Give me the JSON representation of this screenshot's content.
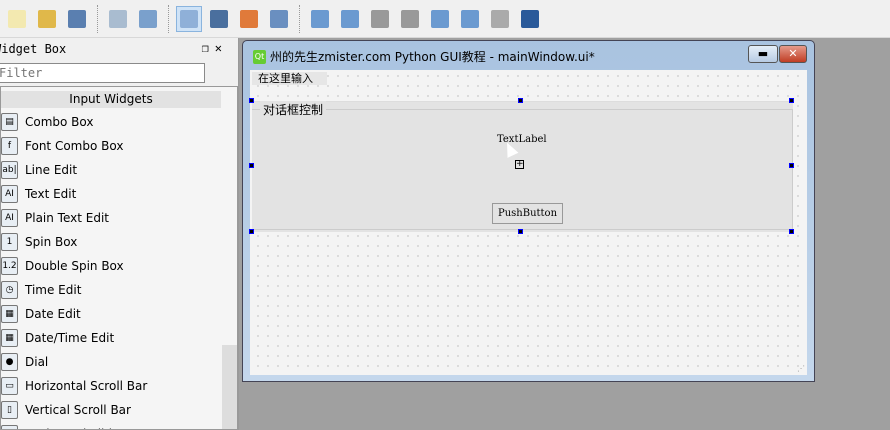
{
  "toolbar": {
    "buttons": [
      "new-file",
      "open-folder",
      "save",
      "send-to-back",
      "bring-to-front",
      "edit-widgets",
      "edit-signals-slots",
      "edit-buddies",
      "edit-tab-order",
      "layout-horizontal",
      "layout-vertical",
      "layout-h-splitter",
      "layout-v-splitter",
      "layout-grid",
      "layout-form",
      "break-layout",
      "adjust-size"
    ],
    "active": "edit-widgets"
  },
  "widget_box": {
    "title": "Widget Box",
    "filter_placeholder": "Filter",
    "category": "Input Widgets",
    "items": [
      {
        "label": "Combo Box",
        "icon": "▤"
      },
      {
        "label": "Font Combo Box",
        "icon": "f"
      },
      {
        "label": "Line Edit",
        "icon": "ab|"
      },
      {
        "label": "Text Edit",
        "icon": "AI"
      },
      {
        "label": "Plain Text Edit",
        "icon": "AI"
      },
      {
        "label": "Spin Box",
        "icon": "1"
      },
      {
        "label": "Double Spin Box",
        "icon": "1.2"
      },
      {
        "label": "Time Edit",
        "icon": "◷"
      },
      {
        "label": "Date Edit",
        "icon": "▦"
      },
      {
        "label": "Date/Time Edit",
        "icon": "▦"
      },
      {
        "label": "Dial",
        "icon": "●"
      },
      {
        "label": "Horizontal Scroll Bar",
        "icon": "▭"
      },
      {
        "label": "Vertical Scroll Bar",
        "icon": "▯"
      },
      {
        "label": "Horizontal Slider",
        "icon": "—"
      }
    ]
  },
  "window": {
    "title": "州的先生zmister.com Python GUI教程 - mainWindow.ui*",
    "menu_placeholder": "在这里输入",
    "group_title": "对话框控制",
    "label": "TextLabel",
    "button": "PushButton"
  }
}
